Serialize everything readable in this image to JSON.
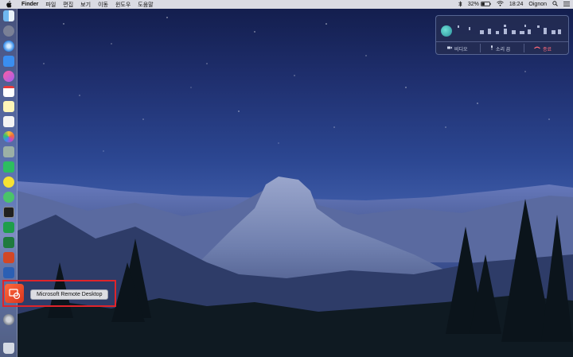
{
  "menubar": {
    "app_name": "Finder",
    "menus": [
      "파일",
      "편집",
      "보기",
      "이동",
      "윈도우",
      "도움말"
    ],
    "battery": "32%",
    "clock": "18:24",
    "user": "Oignon"
  },
  "dock": {
    "items": [
      "finder-icon",
      "launchpad-icon",
      "safari-icon",
      "mail-icon",
      "music-icon",
      "calendar-icon",
      "notes-icon",
      "reminders-icon",
      "photos-icon",
      "facetime-icon",
      "evernote-icon",
      "kakaotalk-icon",
      "messages-icon",
      "terminal-icon",
      "numbers-icon",
      "excel-icon",
      "powerpoint-icon",
      "word-icon",
      "system-preferences-icon",
      "trash-icon"
    ]
  },
  "highlight": {
    "tooltip": "Microsoft Remote Desktop",
    "color": "#e0242a"
  },
  "call_widget": {
    "video_label": "비디오",
    "sound_label": "소리 끔",
    "end_label": "종료",
    "end_color": "#ff6a7a"
  }
}
